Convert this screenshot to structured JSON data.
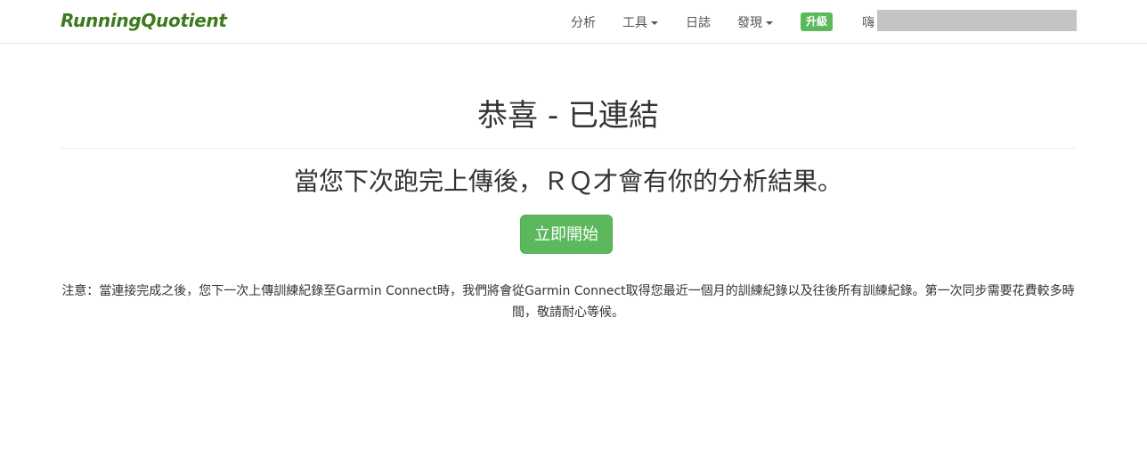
{
  "navbar": {
    "brand": "RunningQuotient",
    "items": [
      {
        "label": "分析",
        "dropdown": false
      },
      {
        "label": "工具",
        "dropdown": true
      },
      {
        "label": "日誌",
        "dropdown": false
      },
      {
        "label": "發現",
        "dropdown": true
      }
    ],
    "upgrade_label": "升級",
    "greeting": "嗨"
  },
  "main": {
    "title": "恭喜 - 已連結",
    "subtitle": "當您下次跑完上傳後，ＲＱ才會有你的分析結果。",
    "start_button": "立即開始",
    "note": "注意：當連接完成之後，您下一次上傳訓練紀錄至Garmin Connect時，我們將會從Garmin Connect取得您最近一個月的訓練紀錄以及往後所有訓練紀錄。第一次同步需要花費較多時間，敬請耐心等候。"
  },
  "colors": {
    "brand": "#3c7a1e",
    "accent_green": "#5cb85c",
    "text": "#333333",
    "nav_text": "#555555",
    "redaction_gray": "#c4c4c4"
  }
}
